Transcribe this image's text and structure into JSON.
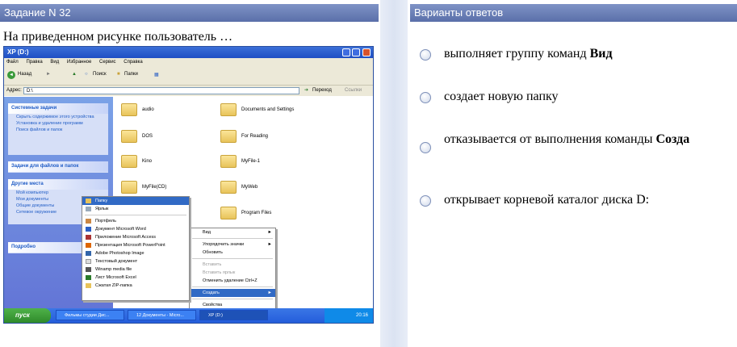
{
  "question": {
    "header": "Задание N 32",
    "text": "На приведенном рисунке пользователь …"
  },
  "answers": {
    "header": "Варианты ответов",
    "options": [
      {
        "pre": "выполняет группу команд ",
        "bold": "Вид"
      },
      {
        "pre": "создает новую папку",
        "bold": ""
      },
      {
        "pre": "отказывается от выполнения команды ",
        "bold": "Созда"
      },
      {
        "pre": "открывает корневой каталог диска D:",
        "bold": ""
      }
    ]
  },
  "screenshot": {
    "window_title": "XP (D:)",
    "menu": [
      "Файл",
      "Правка",
      "Вид",
      "Избранное",
      "Сервис",
      "Справка"
    ],
    "toolbar": {
      "back": "Назад",
      "search": "Поиск",
      "folders": "Папки"
    },
    "address": {
      "label": "Адрес:",
      "value": "D:\\",
      "go": "Переход",
      "links": "Ссылки"
    },
    "left_panels": [
      {
        "title": "Системные задачи",
        "links": [
          "Скрыть содержимое этого устройства",
          "Установка и удаление программ",
          "Поиск файлов и папок"
        ]
      },
      {
        "title": "Задачи для файлов и папок",
        "links": []
      },
      {
        "title": "Другие места",
        "links": [
          "Мой компьютер",
          "Мои документы",
          "Общие документы",
          "Сетевое окружение"
        ]
      },
      {
        "title": "Подробно",
        "links": []
      }
    ],
    "folders": [
      "audio",
      "Documents and Settings",
      "DOS",
      "For Reading",
      "Kino",
      "MyFile-1",
      "MyFile(CD)",
      "MyWeb",
      "Program Files"
    ],
    "context_menu": {
      "items": [
        "Вид",
        "Упорядочить значки",
        "Обновить",
        "Вставить",
        "Вставить ярлык",
        "Отменить удаление   Ctrl+Z",
        "Создать",
        "Свойства"
      ]
    },
    "submenu": {
      "items": [
        "Папку",
        "Ярлык",
        "Портфель",
        "Документ Microsoft Word",
        "Приложение Microsoft Access",
        "Презентация Microsoft PowerPoint",
        "Adobe Photoshop Image",
        "Текстовый документ",
        "Winamp media file",
        "Лист Microsoft Excel",
        "Сжатая ZIP-папка"
      ]
    },
    "taskbar": {
      "start": "пуск",
      "tasks": [
        "Фильмы студии Дис...",
        "12 Документы - Micro...",
        "XP (D:)"
      ],
      "clock": "20:16"
    }
  }
}
